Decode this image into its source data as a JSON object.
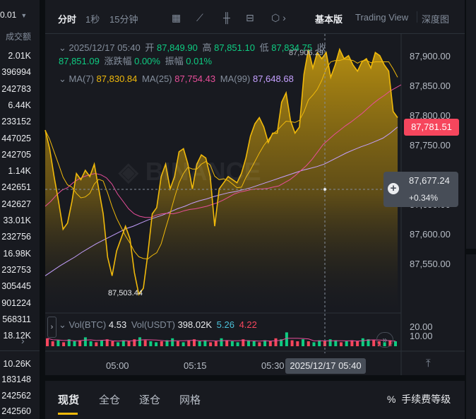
{
  "orderbook": {
    "header": "0.01",
    "col_label": "成交额",
    "rows": [
      {
        "v": "2.01K",
        "c": "w"
      },
      {
        "v": "396994",
        "c": "g"
      },
      {
        "v": "242783",
        "c": "g"
      },
      {
        "v": "6.44K",
        "c": "w"
      },
      {
        "v": "233152",
        "c": "g"
      },
      {
        "v": "447025",
        "c": "g"
      },
      {
        "v": "242705",
        "c": "g"
      },
      {
        "v": "1.14K",
        "c": "w"
      },
      {
        "v": "242651",
        "c": "g"
      },
      {
        "v": "242627",
        "c": "g"
      },
      {
        "v": "33.01K",
        "c": "w"
      },
      {
        "v": "232756",
        "c": "g"
      },
      {
        "v": "16.98K",
        "c": "w"
      },
      {
        "v": "232753",
        "c": "g"
      },
      {
        "v": "305445",
        "c": "g"
      },
      {
        "v": "901224",
        "c": "g"
      },
      {
        "v": "568311",
        "c": "g"
      },
      {
        "v": "18.12K",
        "c": "w"
      }
    ],
    "bottom_rows": [
      {
        "v": "10.26K",
        "c": "w"
      },
      {
        "v": "183148",
        "c": "g"
      },
      {
        "v": "242562",
        "c": "g"
      },
      {
        "v": "242560",
        "c": "g"
      }
    ]
  },
  "toolbar": {
    "time_label": "分时",
    "interval_1s": "1秒",
    "interval_15m": "15分钟",
    "view_basic": "基本版",
    "view_tv": "Trading View",
    "view_depth": "深度图"
  },
  "ohlc": {
    "datetime": "2025/12/17 05:40",
    "open_label": "开",
    "open": "87,849.90",
    "high_label": "高",
    "high": "87,851.10",
    "low_label": "低",
    "low": "87,834.75",
    "close_label": "收",
    "close": "87,851.09",
    "change_label": "涨跌幅",
    "change": "0.00%",
    "amp_label": "振幅",
    "amp": "0.01%"
  },
  "ma": {
    "ma7_label": "MA(7)",
    "ma7": "87,830.84",
    "ma25_label": "MA(25)",
    "ma25": "87,754.43",
    "ma99_label": "MA(99)",
    "ma99": "87,648.68"
  },
  "volume": {
    "btc_label": "Vol(BTC)",
    "btc": "4.53",
    "usdt_label": "Vol(USDT)",
    "usdt": "398.02K",
    "v1": "5.26",
    "v2": "4.22"
  },
  "y_axis": [
    "87,900.00",
    "87,850.00",
    "87,800.00",
    "87,750.00",
    "87,650.00",
    "87,600.00",
    "87,550.00"
  ],
  "vol_axis": [
    "20.00",
    "10.00"
  ],
  "x_axis": [
    "05:00",
    "05:15",
    "05:30"
  ],
  "last_price": "87,781.51",
  "crosshair": {
    "price": "87,677.24",
    "pct": "+0.34%",
    "time": "2025/12/17 05:40"
  },
  "annotations": {
    "max": "87,906.29",
    "min": "87,503.44"
  },
  "tabs": {
    "spot": "现货",
    "cross": "全仓",
    "isolated": "逐仓",
    "grid": "网格",
    "fee": "手续费等级"
  },
  "colors": {
    "up": "#0ecb81",
    "down": "#f6465d",
    "price_line": "#f0b90b",
    "ma25": "#e84e9a",
    "ma99": "#c5a0ff"
  },
  "chart_data": {
    "type": "area",
    "y_range": [
      87480,
      87930
    ],
    "price": [
      87775,
      87745,
      87700,
      87660,
      87615,
      87625,
      87660,
      87705,
      87695,
      87710,
      87700,
      87720,
      87680,
      87640,
      87570,
      87540,
      87580,
      87600,
      87620,
      87600,
      87545,
      87510,
      87520,
      87575,
      87640,
      87650,
      87700,
      87720,
      87680,
      87700,
      87740,
      87745,
      87720,
      87680,
      87720,
      87735,
      87730,
      87700,
      87620,
      87680,
      87690,
      87700,
      87695,
      87690,
      87705,
      87730,
      87765,
      87785,
      87795,
      87780,
      87755,
      87770,
      87770,
      87820,
      87835,
      87790,
      87770,
      87780,
      87865,
      87905,
      87875,
      87900,
      87890,
      87900,
      87860,
      87880,
      87905,
      87890,
      87895,
      87880,
      87870,
      87885,
      87890,
      87875,
      87900,
      87895,
      87880,
      87870,
      87805,
      87795
    ],
    "ma25": [
      87652,
      87660,
      87670,
      87678,
      87682,
      87690,
      87696,
      87700,
      87703,
      87705,
      87703,
      87698,
      87688,
      87672,
      87660,
      87648,
      87640,
      87636,
      87634,
      87634,
      87638,
      87640,
      87641,
      87640,
      87642,
      87645,
      87647,
      87648,
      87650,
      87652,
      87655,
      87658,
      87662,
      87667,
      87672,
      87675,
      87677,
      87679,
      87680,
      87680,
      87681,
      87683,
      87685,
      87690,
      87695,
      87702,
      87710,
      87718,
      87728,
      87740,
      87752,
      87760,
      87768,
      87775,
      87782,
      87788,
      87795,
      87802,
      87810,
      87818,
      87825,
      87831,
      87838,
      87843,
      87848
    ],
    "ma99": [
      87540,
      87548,
      87556,
      87563,
      87570,
      87578,
      87585,
      87592,
      87598,
      87604,
      87610,
      87616,
      87620,
      87625,
      87630,
      87634,
      87638,
      87643,
      87648,
      87652,
      87657,
      87661,
      87664,
      87668,
      87671,
      87674,
      87676,
      87679,
      87682,
      87686,
      87690,
      87694,
      87698,
      87702,
      87706,
      87710,
      87713,
      87716,
      87720,
      87726,
      87732,
      87738,
      87743,
      87748,
      87752,
      87757,
      87762,
      87770,
      87780
    ],
    "volume": [
      8,
      5,
      6,
      4,
      7,
      5,
      6,
      9,
      5,
      4,
      6,
      7,
      5,
      4,
      6,
      5,
      7,
      9,
      6,
      5,
      4,
      5,
      6,
      8,
      5,
      4,
      6,
      7,
      5,
      6,
      4,
      5,
      8,
      6,
      5,
      4,
      7,
      6,
      5,
      4,
      6,
      5,
      8,
      7,
      14,
      6,
      5,
      7,
      5,
      4,
      6,
      5,
      7,
      6,
      4,
      5,
      6,
      5,
      8,
      7,
      6,
      5,
      4,
      6,
      5
    ]
  }
}
